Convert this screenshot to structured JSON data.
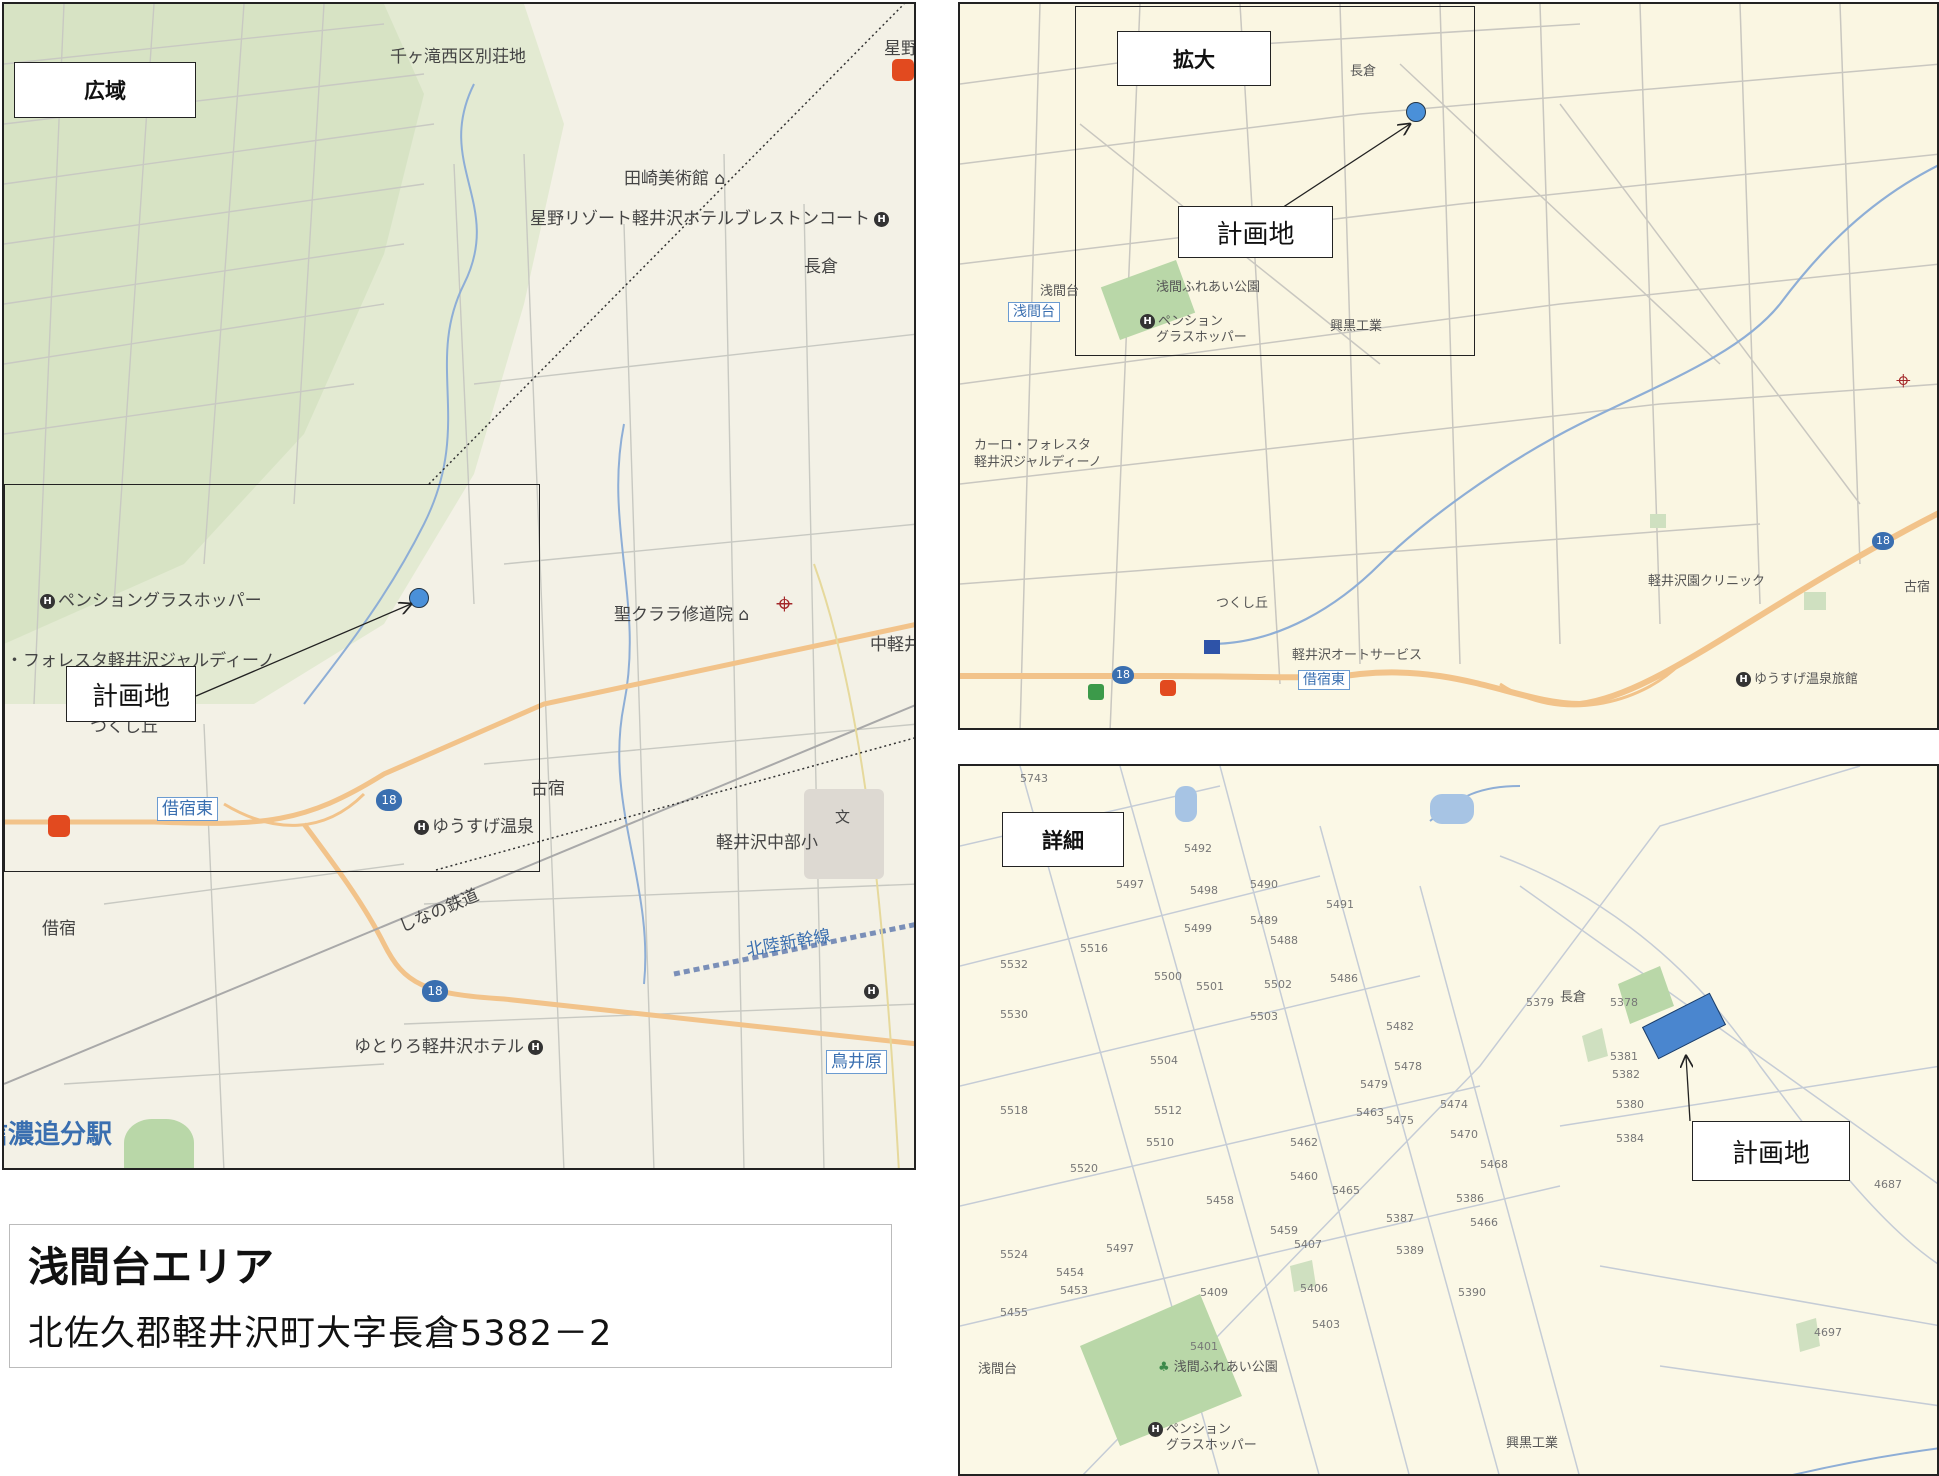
{
  "wide": {
    "tag": "広域",
    "labels": {
      "senga": "千ヶ滝西区別荘地",
      "hoshino": "星野",
      "tazaki": "田崎美術館",
      "resort": "星野リゾート軽井沢ホテルブレストンコート",
      "nagakura": "長倉",
      "pension": "ペンショングラスホッパー",
      "foresta": "・フォレスタ軽井沢ジャルディーノ",
      "tsukushi": "つくし丘",
      "clara": "聖クララ修道院",
      "nakakaru": "中軽井",
      "kariyado_east": "借宿東",
      "yusuge": "ゆうすげ温泉",
      "furujuku": "古宿",
      "school_mark": "文",
      "school": "軽井沢中部小",
      "kariyado": "借宿",
      "shinano": "しなの鉄道",
      "shinkansen": "北陸新幹線",
      "route": "18",
      "yutoriro": "ゆとりろ軽井沢ホテル",
      "toriihara": "鳥井原",
      "station": "信濃追分駅"
    },
    "site_label": "計画地"
  },
  "zoom": {
    "tag": "拡大",
    "site_label": "計画地",
    "labels": {
      "nagakura": "長倉",
      "asamadai": "浅間台",
      "asamadai_badge": "浅間台",
      "park": "浅間ふれあい公園",
      "pension_1": "ペンション",
      "pension_2": "グラスホッパー",
      "kohkuro": "興黒工業",
      "carlo_1": "カーロ・フォレスタ",
      "carlo_2": "軽井沢ジャルディーノ",
      "tsukushi": "つくし丘",
      "auto": "軽井沢オートサービス",
      "kariyado_east": "借宿東",
      "clinic": "軽井沢園クリニック",
      "yusuge": "ゆうすげ温泉旅館",
      "furu": "古宿",
      "route": "18"
    }
  },
  "detail": {
    "tag": "詳細",
    "site_label": "計画地",
    "labels": {
      "nagakura": "長倉",
      "asamadai": "浅間台",
      "park": "浅間ふれあい公園",
      "pension_1": "ペンション",
      "pension_2": "グラスホッパー",
      "kohkuro": "興黒工業"
    },
    "lots": [
      "5743",
      "5492",
      "5497",
      "5498",
      "5490",
      "5491",
      "5499",
      "5489",
      "5488",
      "5516",
      "5532",
      "5500",
      "5501",
      "5502",
      "5486",
      "5530",
      "5503",
      "5482",
      "5504",
      "5478",
      "5479",
      "5518",
      "5512",
      "5463",
      "5475",
      "5474",
      "5510",
      "5462",
      "5470",
      "5520",
      "5460",
      "5468",
      "5465",
      "5458",
      "5386",
      "5459",
      "5387",
      "5466",
      "5497",
      "5407",
      "5389",
      "5524",
      "5454",
      "5453",
      "5409",
      "5406",
      "5390",
      "5455",
      "5403",
      "5401",
      "5379",
      "5378",
      "5381",
      "5382",
      "5380",
      "5384",
      "4687",
      "4697"
    ]
  },
  "info": {
    "title": "浅間台エリア",
    "address": "北佐久郡軽井沢町大字長倉5382－2"
  }
}
